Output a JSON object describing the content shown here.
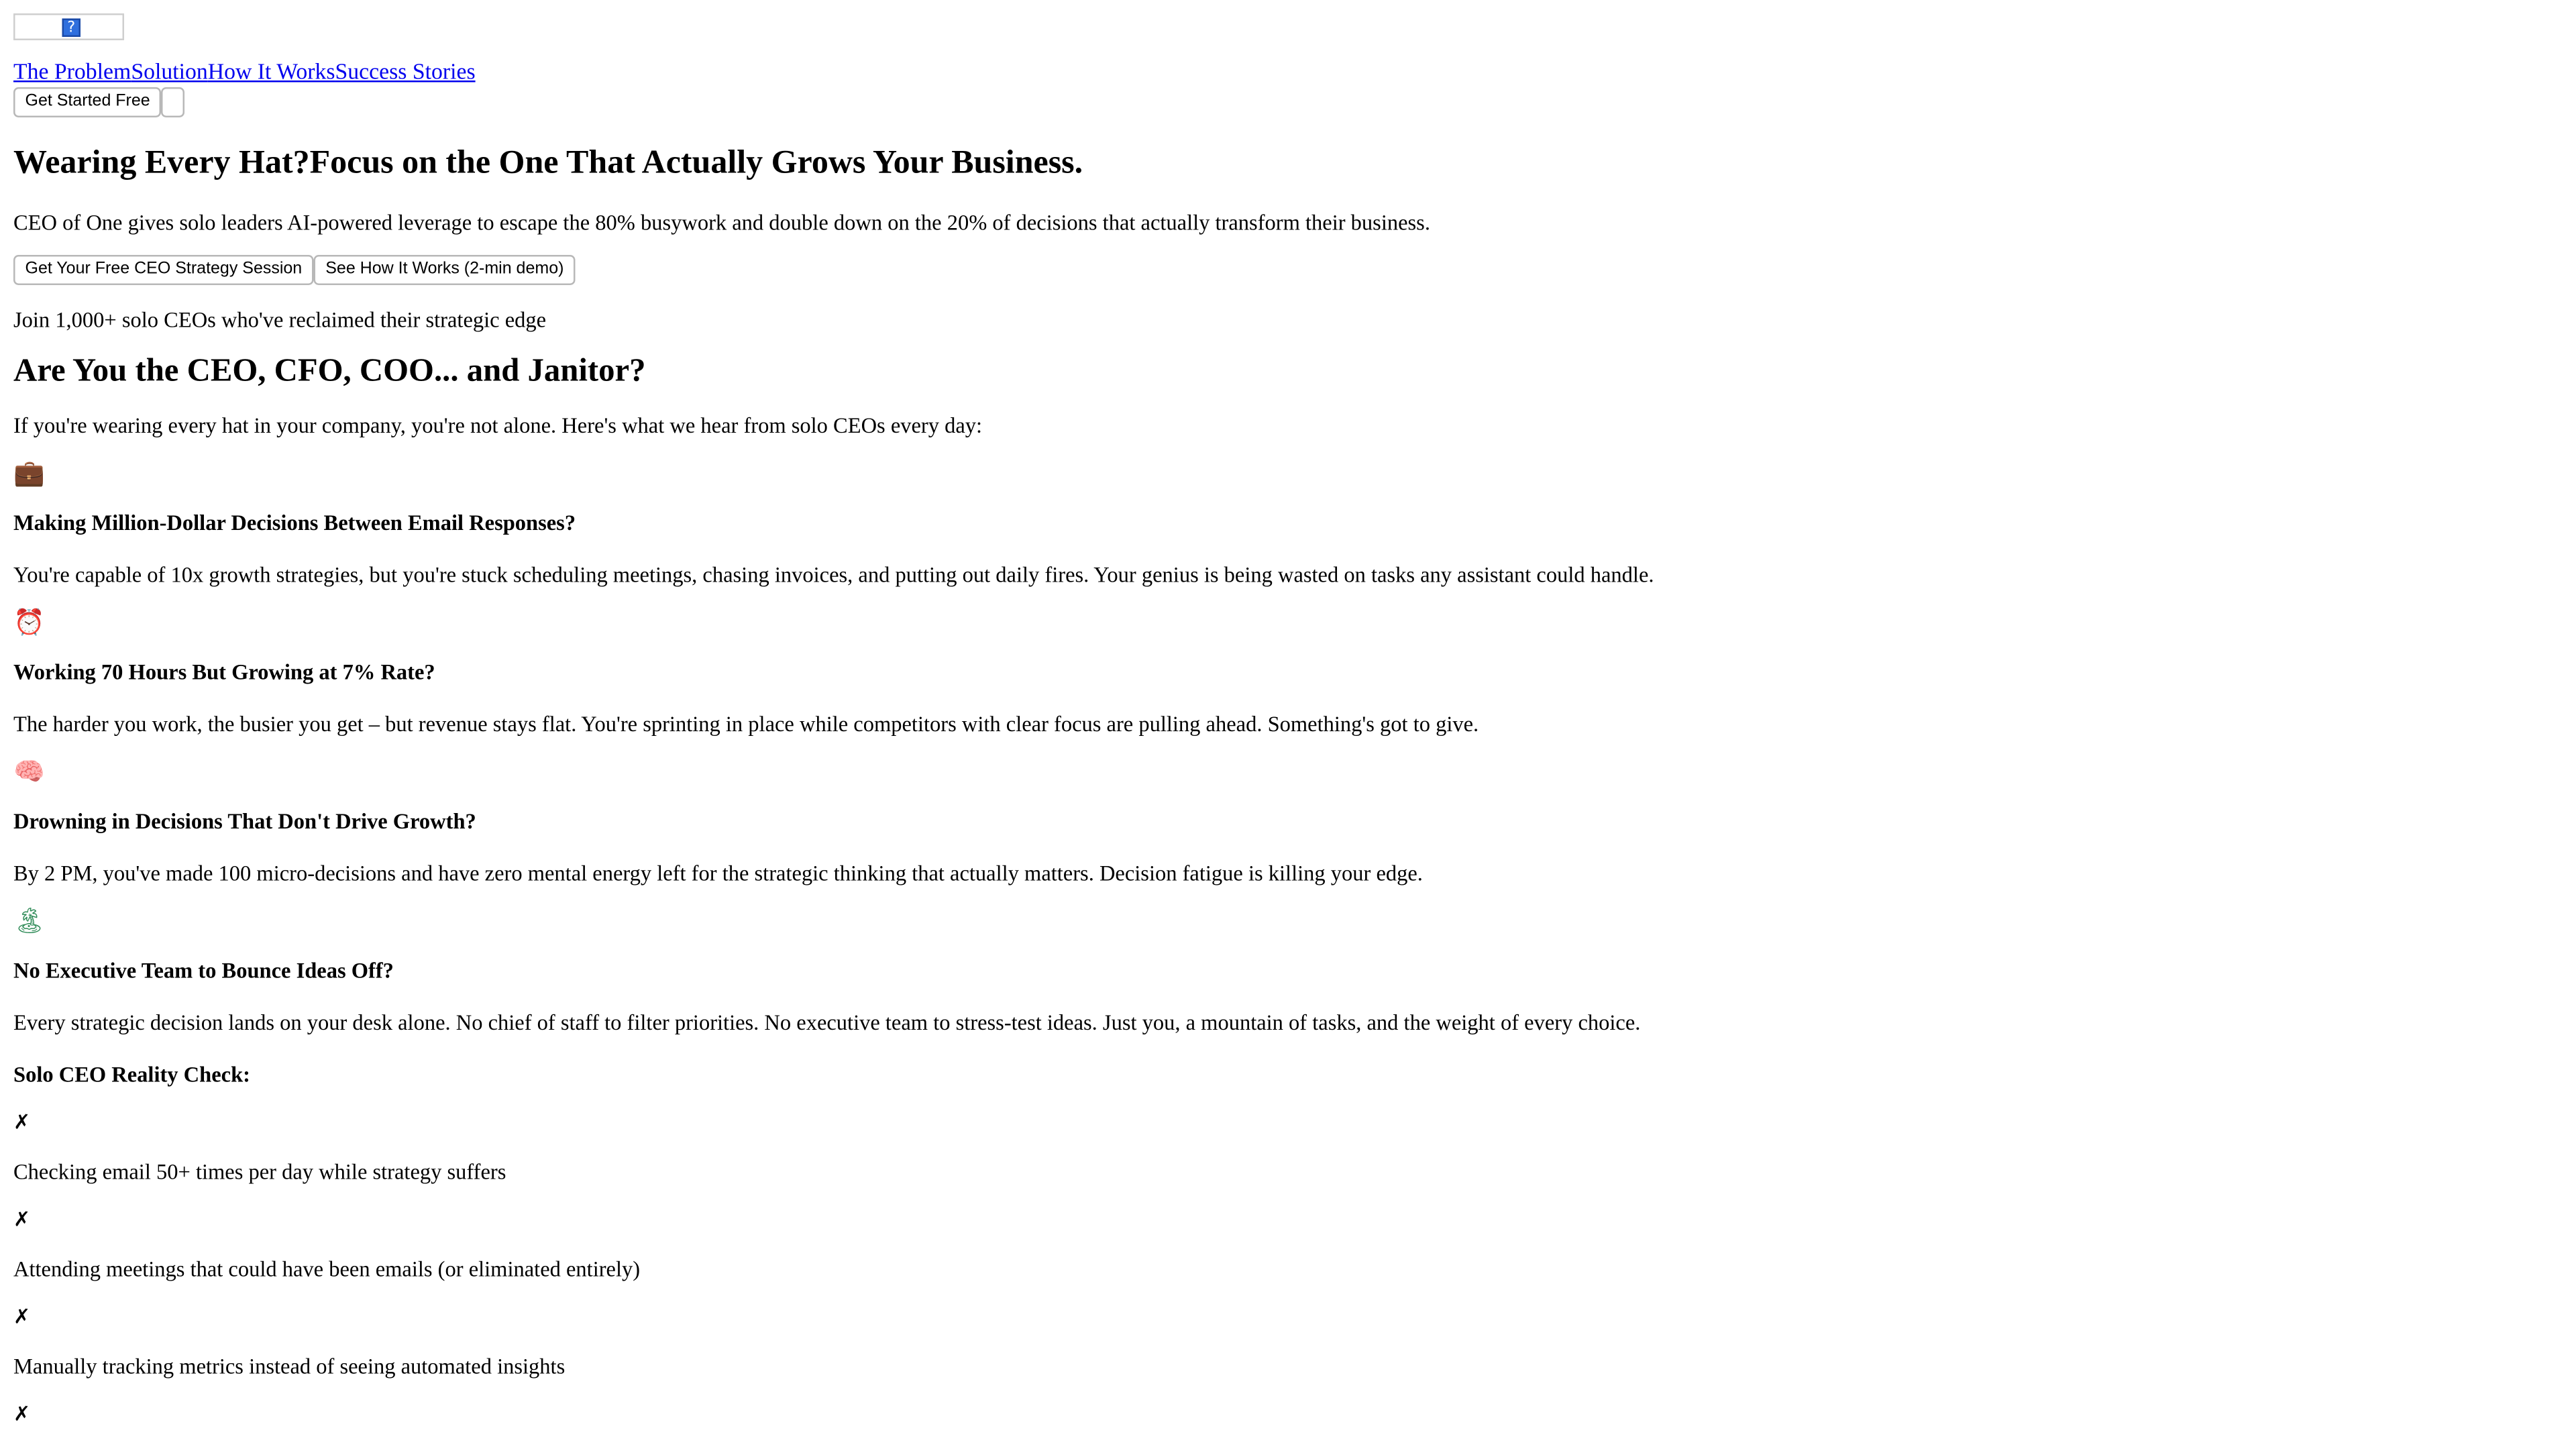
{
  "header": {
    "logo_icon": "question-mark-image-icon",
    "nav": [
      {
        "label": "The Problem"
      },
      {
        "label": "Solution"
      },
      {
        "label": "How It Works"
      },
      {
        "label": "Success Stories"
      }
    ],
    "cta_label": "Get Started Free",
    "secondary_button_label": ""
  },
  "hero": {
    "title": "Wearing Every Hat?Focus on the One That Actually Grows Your Business.",
    "subtitle": "CEO of One gives solo leaders AI-powered leverage to escape the 80% busywork and double down on the 20% of decisions that actually transform their business.",
    "primary_button": "Get Your Free CEO Strategy Session",
    "secondary_button": "See How It Works (2-min demo)",
    "social_proof": "Join 1,000+ solo CEOs who've reclaimed their strategic edge"
  },
  "problem": {
    "title": "Are You the CEO, CFO, COO... and Janitor?",
    "intro": "If you're wearing every hat in your company, you're not alone. Here's what we hear from solo CEOs every day:",
    "items": [
      {
        "icon": "💼",
        "icon_name": "briefcase-icon",
        "title": "Making Million-Dollar Decisions Between Email Responses?",
        "text": "You're capable of 10x growth strategies, but you're stuck scheduling meetings, chasing invoices, and putting out daily fires. Your genius is being wasted on tasks any assistant could handle."
      },
      {
        "icon": "⏰",
        "icon_name": "alarm-clock-icon",
        "title": "Working 70 Hours But Growing at 7% Rate?",
        "text": "The harder you work, the busier you get – but revenue stays flat. You're sprinting in place while competitors with clear focus are pulling ahead. Something's got to give."
      },
      {
        "icon": "🧠",
        "icon_name": "brain-icon",
        "title": "Drowning in Decisions That Don't Drive Growth?",
        "text": "By 2 PM, you've made 100 micro-decisions and have zero mental energy left for the strategic thinking that actually matters. Decision fatigue is killing your edge."
      },
      {
        "icon": "🏝",
        "icon_name": "desert-island-icon",
        "title": "No Executive Team to Bounce Ideas Off?",
        "text": "Every strategic decision lands on your desk alone. No chief of staff to filter priorities. No executive team to stress-test ideas. Just you, a mountain of tasks, and the weight of every choice."
      }
    ]
  },
  "reality_check": {
    "title": "Solo CEO Reality Check:",
    "mark": "✗",
    "items": [
      "Checking email 50+ times per day while strategy suffers",
      "Attending meetings that could have been emails (or eliminated entirely)",
      "Manually tracking metrics instead of seeing automated insights"
    ]
  }
}
